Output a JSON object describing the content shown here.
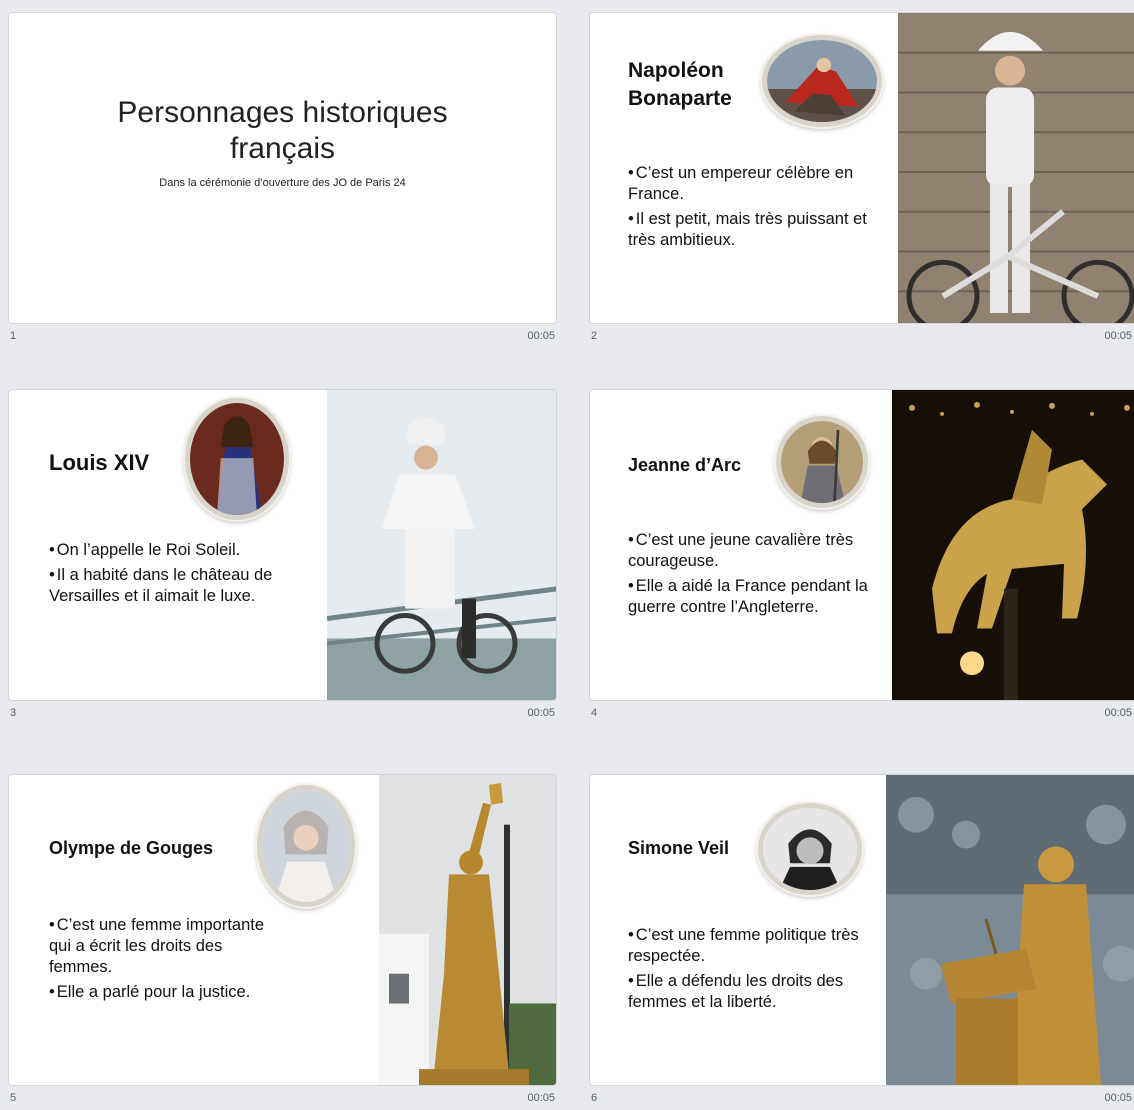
{
  "slides": [
    {
      "number": "1",
      "duration": "00:05",
      "title_line1": "Personnages historiques",
      "title_line2": "français",
      "subtitle": "Dans la cérémonie d’ouverture des JO de Paris 24"
    },
    {
      "number": "2",
      "duration": "00:05",
      "title_line1": "Napoléon",
      "title_line2": "Bonaparte",
      "bullets": [
        "C’est un empereur célèbre en France.",
        "Il est petit, mais très puissant et très ambitieux."
      ]
    },
    {
      "number": "3",
      "duration": "00:05",
      "title": "Louis XIV",
      "bullets": [
        "On l’appelle le Roi Soleil.",
        "Il a habité dans le château de Versailles et il aimait le luxe."
      ]
    },
    {
      "number": "4",
      "duration": "00:05",
      "title": "Jeanne d’Arc",
      "bullets": [
        "C’est une jeune cavalière très courageuse.",
        "Elle a aidé la France pendant la guerre contre l’Angleterre."
      ]
    },
    {
      "number": "5",
      "duration": "00:05",
      "title": "Olympe de Gouges",
      "bullets": [
        "C’est une femme importante qui a écrit les droits des femmes.",
        "Elle a parlé pour la justice."
      ]
    },
    {
      "number": "6",
      "duration": "00:05",
      "title": "Simone Veil",
      "bullets": [
        "C’est une femme politique très respectée.",
        "Elle a défendu les droits des femmes et la liberté."
      ]
    }
  ]
}
